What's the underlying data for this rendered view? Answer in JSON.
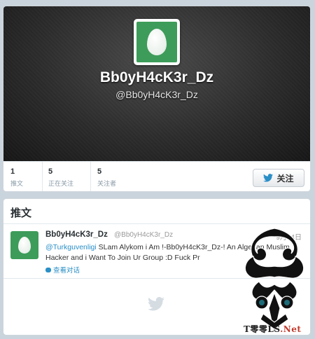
{
  "profile": {
    "display_name": "Bb0yH4cK3r_Dz",
    "handle": "@Bb0yH4cK3r_Dz",
    "avatar_color": "#3d9c5a"
  },
  "stats": [
    {
      "count": "1",
      "label": "推文"
    },
    {
      "count": "5",
      "label": "正在关注"
    },
    {
      "count": "5",
      "label": "关注者"
    }
  ],
  "follow_button": {
    "label": "关注",
    "icon": "twitter-bird-icon"
  },
  "tweets_section": {
    "title": "推文",
    "tweets": [
      {
        "name": "Bb0yH4cK3r_Dz",
        "handle": "@Bb0yH4cK3r_Dz",
        "date": "9月14日",
        "mention": "@Turkguvenligi",
        "text": " SLam Alykom i Am !-Bb0yH4cK3r_Dz-! An Algerian Muslim Hacker and i Want To Join Ur Group :D Fuck Pr",
        "view_conversation": "查看对话"
      }
    ]
  },
  "watermark": {
    "text_main": "T零零LS",
    "text_net": ".Net"
  },
  "colors": {
    "link": "#2a8fc7",
    "header_dark": "#2b2b2b"
  }
}
